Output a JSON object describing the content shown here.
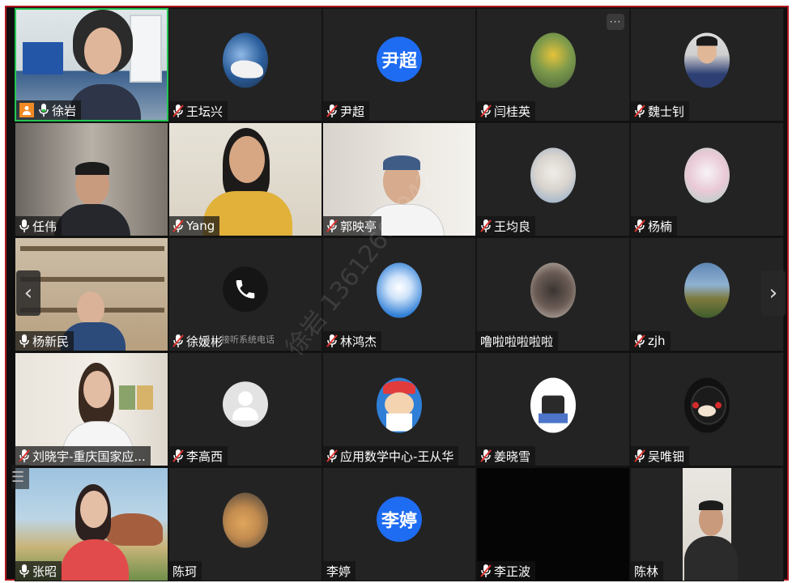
{
  "participants": [
    {
      "name": "徐岩",
      "mic": "on",
      "host": true,
      "type": "video"
    },
    {
      "name": "王坛兴",
      "mic": "muted",
      "type": "avatar"
    },
    {
      "name": "尹超",
      "mic": "muted",
      "type": "text",
      "avatar_text": "尹超"
    },
    {
      "name": "闫桂英",
      "mic": "muted",
      "type": "avatar"
    },
    {
      "name": "魏士钊",
      "mic": "muted",
      "type": "avatar"
    },
    {
      "name": "任伟",
      "mic": "on",
      "type": "video"
    },
    {
      "name": "Yang",
      "mic": "muted",
      "type": "video"
    },
    {
      "name": "郭映亭",
      "mic": "muted",
      "type": "video"
    },
    {
      "name": "王均良",
      "mic": "muted",
      "type": "avatar"
    },
    {
      "name": "杨楠",
      "mic": "muted",
      "type": "avatar"
    },
    {
      "name": "杨新民",
      "mic": "on",
      "type": "video"
    },
    {
      "name": "徐媛彬",
      "mic": "muted",
      "type": "phone",
      "subtext": "接听系统电话"
    },
    {
      "name": "林鸿杰",
      "mic": "muted",
      "type": "avatar"
    },
    {
      "name": "噜啦啦啦啦啦",
      "mic": "none",
      "type": "avatar"
    },
    {
      "name": "zjh",
      "mic": "muted",
      "type": "avatar"
    },
    {
      "name": "刘晓宇-重庆国家应...",
      "mic": "muted",
      "type": "video"
    },
    {
      "name": "李高西",
      "mic": "muted",
      "type": "default"
    },
    {
      "name": "应用数学中心-王从华",
      "mic": "muted",
      "type": "avatar"
    },
    {
      "name": "姜晓雪",
      "mic": "muted",
      "type": "avatar"
    },
    {
      "name": "吴唯钿",
      "mic": "muted",
      "type": "avatar"
    },
    {
      "name": "张昭",
      "mic": "on",
      "type": "video"
    },
    {
      "name": "陈珂",
      "mic": "none",
      "type": "avatar"
    },
    {
      "name": "李婷",
      "mic": "none",
      "type": "text",
      "avatar_text": "李婷"
    },
    {
      "name": "李正波",
      "mic": "muted",
      "type": "black"
    },
    {
      "name": "陈林",
      "mic": "none",
      "type": "video"
    }
  ],
  "controls": {
    "more_label": "···",
    "prev_arrow": "‹",
    "next_arrow": "›",
    "list_icon": "☰"
  },
  "watermark": "徐岩 13612608942",
  "colors": {
    "accent_active": "#23c552",
    "frame": "#b0151d",
    "avatar_blue": "#1e6cf2",
    "muted_red": "#e0332f"
  }
}
